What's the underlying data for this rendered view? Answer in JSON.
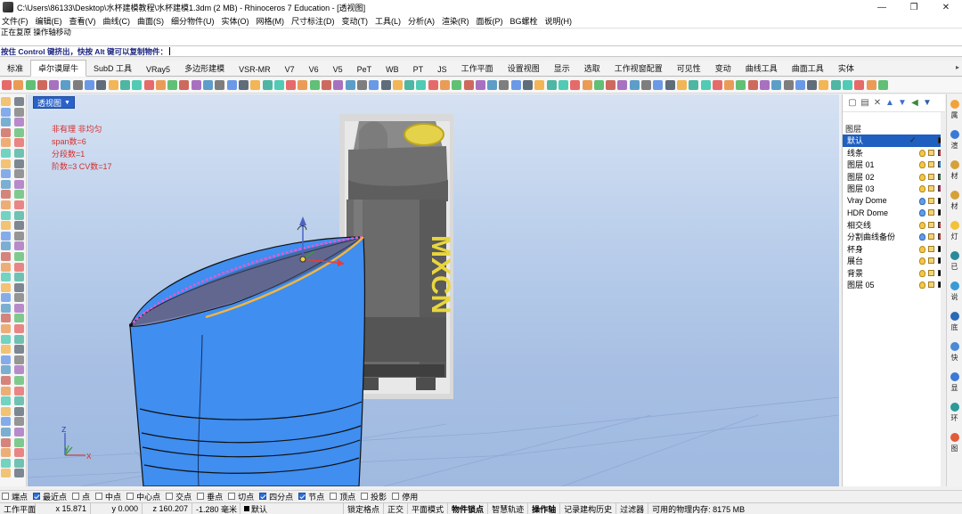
{
  "window": {
    "title": "C:\\Users\\86133\\Desktop\\水杯建模教程\\水杯建模1.3dm (2 MB) - Rhinoceros 7 Education - [透视图]",
    "controls": [
      "—",
      "❐",
      "✕"
    ]
  },
  "menu": [
    "文件(F)",
    "编辑(E)",
    "查看(V)",
    "曲线(C)",
    "曲面(S)",
    "细分物件(U)",
    "实体(O)",
    "网格(M)",
    "尺寸标注(D)",
    "变动(T)",
    "工具(L)",
    "分析(A)",
    "渲染(R)",
    "面板(P)",
    "BG螺栓",
    "说明(H)"
  ],
  "command": {
    "history": [
      "正在复原 操作轴移动"
    ],
    "prompt": "按住 Control 键挤出，快按 Alt 键可以复制物件："
  },
  "tabs": [
    "标准",
    "卓尔谟犀牛",
    "SubD 工具",
    "VRay5",
    "多边形建模",
    "VSR-MR",
    "V7",
    "V6",
    "V5",
    "PeT",
    "WB",
    "PT",
    "JS",
    "工作平面",
    "设置视图",
    "显示",
    "选取",
    "工作视窗配置",
    "可见性",
    "变动",
    "曲线工具",
    "曲面工具",
    "实体"
  ],
  "active_tab": "卓尔谟犀牛",
  "viewport": {
    "label": "透视图",
    "annotations": [
      "非有理  非均匀",
      "span数=6",
      "分段数=1",
      "阶数=3   CV数=17"
    ],
    "axis_labels": {
      "x": "x",
      "y": "y",
      "z": "z"
    },
    "product_text": "MXCN"
  },
  "layers_panel": {
    "header": "图层",
    "tool_icons": [
      "new-layer-icon",
      "new-sublayer-icon",
      "delete-icon",
      "move-up-icon",
      "move-down-icon",
      "move-parent-icon",
      "filter-icon"
    ],
    "layers": [
      {
        "name": "默认",
        "current": true,
        "color": "#000000"
      },
      {
        "name": "线条",
        "color": "#d32f2f"
      },
      {
        "name": "图层 01",
        "color": "#1e88e5"
      },
      {
        "name": "图层 02",
        "color": "#2e7d32"
      },
      {
        "name": "图层 03",
        "color": "#d81b60"
      },
      {
        "name": "Vray Dome",
        "color": "#000000"
      },
      {
        "name": "HDR Dome",
        "color": "#000000"
      },
      {
        "name": "相交线",
        "color": "#d32f2f"
      },
      {
        "name": "分割曲线备份",
        "color": "#d32f2f"
      },
      {
        "name": "杯身",
        "color": "#000000"
      },
      {
        "name": "展台",
        "color": "#000000"
      },
      {
        "name": "背景",
        "color": "#000000"
      },
      {
        "name": "图层 05",
        "color": "#000000"
      }
    ]
  },
  "side_tabs": [
    "属",
    "渲",
    "材",
    "材",
    "灯",
    "已",
    "说",
    "底",
    "快",
    "显",
    "环",
    "图"
  ],
  "osnap": [
    {
      "label": "端点",
      "on": false
    },
    {
      "label": "最近点",
      "on": true
    },
    {
      "label": "点",
      "on": false
    },
    {
      "label": "中点",
      "on": false
    },
    {
      "label": "中心点",
      "on": false
    },
    {
      "label": "交点",
      "on": false
    },
    {
      "label": "垂点",
      "on": false
    },
    {
      "label": "切点",
      "on": false
    },
    {
      "label": "四分点",
      "on": true
    },
    {
      "label": "节点",
      "on": true
    },
    {
      "label": "顶点",
      "on": false
    },
    {
      "label": "投影",
      "on": false
    },
    {
      "label": "停用",
      "on": false
    }
  ],
  "status": {
    "cplane": "工作平面",
    "x": "x 15.871",
    "y": "y 0.000",
    "z": "z 160.207",
    "dist": "-1.280 毫米",
    "layer": "默认",
    "toggles": [
      "锁定格点",
      "正交",
      "平面模式",
      "物件锁点",
      "智慧轨迹",
      "操作轴",
      "记录建构历史",
      "过滤器"
    ],
    "bold_toggles": [
      "物件锁点",
      "操作轴"
    ],
    "memory": "可用的物理内存: 8175 MB"
  }
}
